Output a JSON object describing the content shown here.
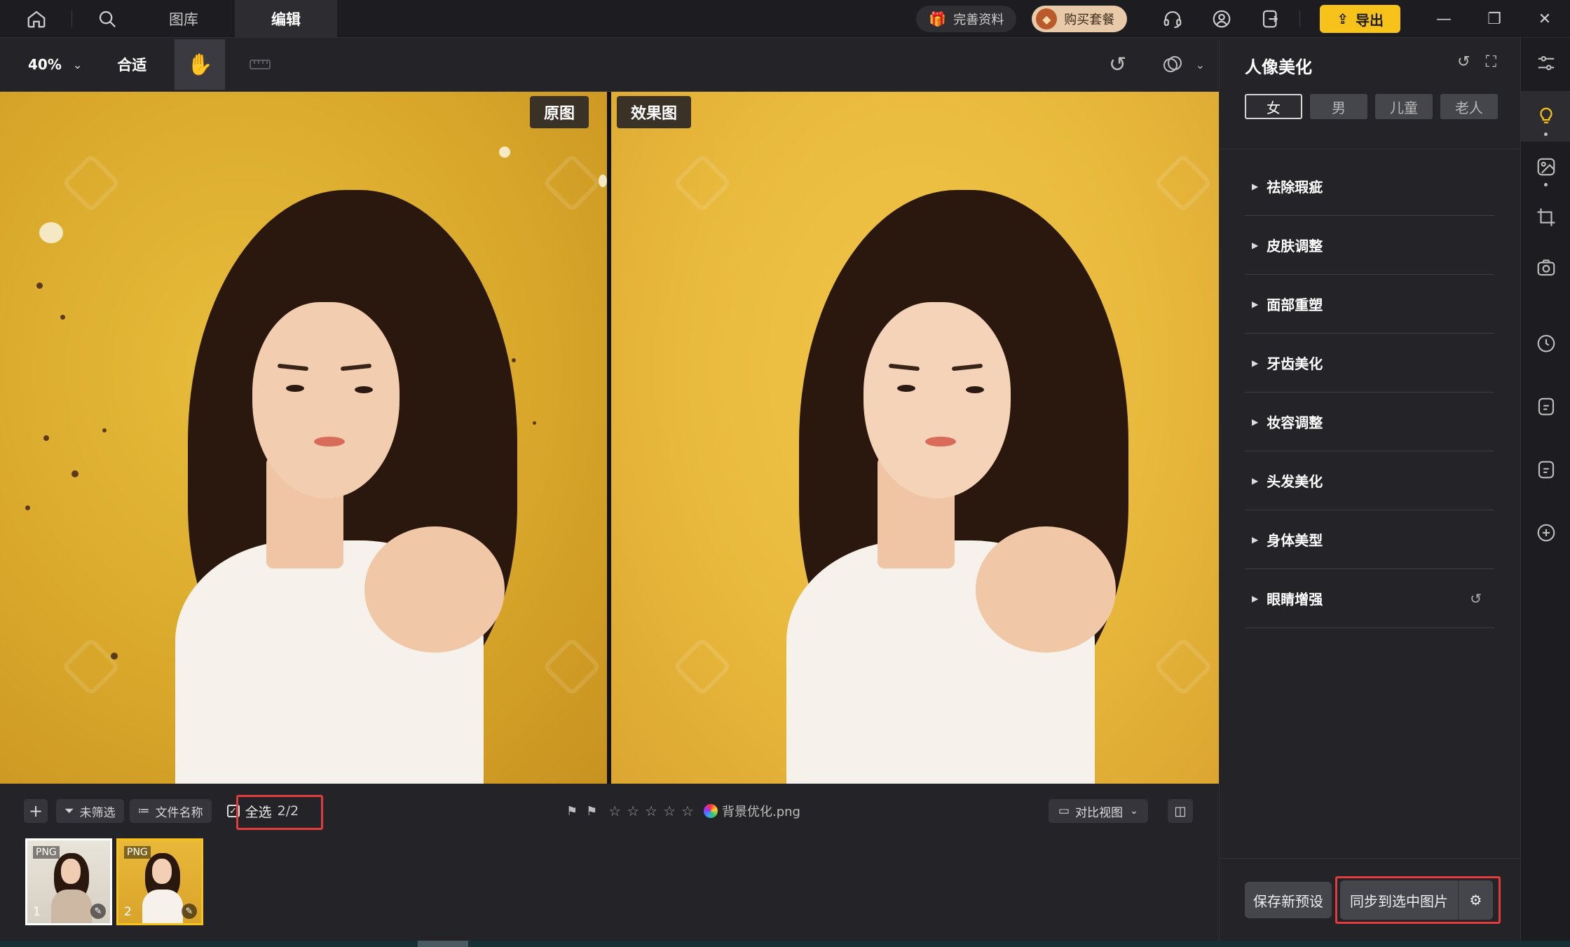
{
  "topbar": {
    "tabs": [
      {
        "label": "图库"
      },
      {
        "label": "编辑"
      }
    ],
    "complete_info": "完善资料",
    "buy_package": "购买套餐",
    "export_label": "导出"
  },
  "toolbar": {
    "zoom": "40%",
    "fit": "合适"
  },
  "canvas": {
    "original_label": "原图",
    "effect_label": "效果图"
  },
  "filmstrip": {
    "filter_label": "未筛选",
    "sort_label": "文件名称",
    "select_all_label": "全选",
    "select_count": "2/2",
    "filename": "背景优化.png",
    "compare_view": "对比视图",
    "rating": 0,
    "thumbs": [
      {
        "format": "PNG",
        "index": "1"
      },
      {
        "format": "PNG",
        "index": "2"
      }
    ]
  },
  "panel": {
    "title": "人像美化",
    "genders": [
      {
        "label": "女"
      },
      {
        "label": "男"
      },
      {
        "label": "儿童"
      },
      {
        "label": "老人"
      }
    ],
    "sections": [
      {
        "label": "祛除瑕疵"
      },
      {
        "label": "皮肤调整"
      },
      {
        "label": "面部重塑"
      },
      {
        "label": "牙齿美化"
      },
      {
        "label": "妆容调整"
      },
      {
        "label": "头发美化"
      },
      {
        "label": "身体美型"
      },
      {
        "label": "眼睛增强"
      }
    ],
    "save_preset": "保存新预设",
    "sync_label": "同步到选中图片"
  },
  "colors": {
    "accent": "#f7c21a",
    "highlight_box": "#e23b3b"
  }
}
